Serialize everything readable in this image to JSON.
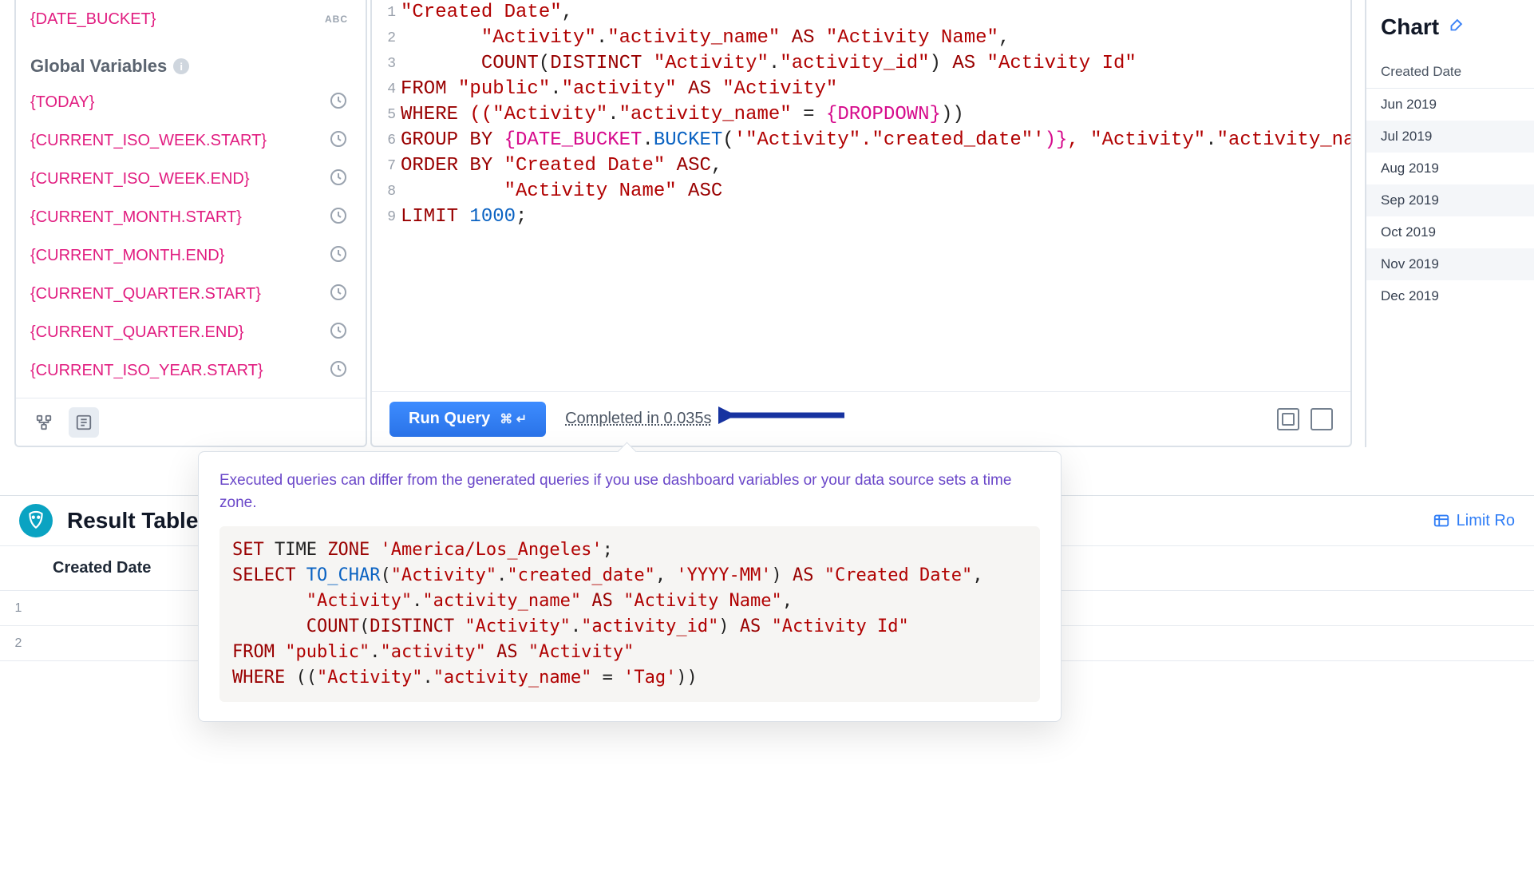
{
  "sidebar": {
    "first_var": "{DATE_BUCKET}",
    "first_var_type": "ABC",
    "section_title": "Global Variables",
    "items": [
      "{TODAY}",
      "{CURRENT_ISO_WEEK.START}",
      "{CURRENT_ISO_WEEK.END}",
      "{CURRENT_MONTH.START}",
      "{CURRENT_MONTH.END}",
      "{CURRENT_QUARTER.START}",
      "{CURRENT_QUARTER.END}",
      "{CURRENT_ISO_YEAR.START}"
    ]
  },
  "editor": {
    "line_numbers": [
      "1",
      "2",
      "3",
      "4",
      "5",
      "6",
      "7",
      "8",
      "9"
    ],
    "run_label": "Run Query",
    "run_shortcut": "⌘ ↵",
    "completed_label": "Completed in 0.035s"
  },
  "sql_tokens": {
    "l1_a": "\"Created Date\"",
    "l1_b": ",",
    "l2_a": "       \"Activity\"",
    "l2_b": ".",
    "l2_c": "\"activity_name\"",
    "l2_d": " AS ",
    "l2_e": "\"Activity Name\"",
    "l2_f": ",",
    "l3_a": "       COUNT",
    "l3_b": "(",
    "l3_c": "DISTINCT",
    "l3_d": " \"Activity\"",
    "l3_e": ".",
    "l3_f": "\"activity_id\"",
    "l3_g": ") ",
    "l3_h": "AS",
    "l3_i": " \"Activity Id\"",
    "l4_a": "FROM ",
    "l4_b": "\"public\"",
    "l4_c": ".",
    "l4_d": "\"activity\"",
    "l4_e": " AS ",
    "l4_f": "\"Activity\"",
    "l5_a": "WHERE ",
    "l5_b": "((\"Activity\"",
    "l5_c": ".",
    "l5_d": "\"activity_name\"",
    "l5_e": " = ",
    "l5_f": "{DROPDOWN}",
    "l5_g": "))",
    "l6_a": "GROUP BY ",
    "l6_b": "{DATE_BUCKET",
    "l6_c": ".",
    "l6_d": "BUCKET",
    "l6_e": "(",
    "l6_f": "'\"Activity\".\"created_date\"'",
    "l6_g": ")}",
    "l6_h": ", \"Activity\"",
    "l6_i": ".",
    "l6_j": "\"activity_name\"",
    "l7_a": "ORDER BY ",
    "l7_b": "\"Created Date\"",
    "l7_c": " ASC",
    "l7_d": ",",
    "l8_a": "         \"Activity Name\"",
    "l8_b": " ASC",
    "l9_a": "LIMIT ",
    "l9_b": "1000",
    "l9_c": ";"
  },
  "chart": {
    "title": "Chart",
    "header": "Created Date",
    "rows": [
      "Jun 2019",
      "Jul 2019",
      "Aug 2019",
      "Sep 2019",
      "Oct 2019",
      "Nov 2019",
      "Dec 2019"
    ]
  },
  "results": {
    "title": "Result Table",
    "col0": "Created Date",
    "limit_label": "Limit Ro",
    "row_nums": [
      "1",
      "2"
    ]
  },
  "popover": {
    "msg": "Executed queries can differ from the generated queries if you use dashboard variables or your data source sets a time zone."
  },
  "popover_sql": {
    "l1_a": "SET",
    "l1_b": " TIME ",
    "l1_c": "ZONE",
    "l1_d": " ",
    "l1_e": "'America/Los_Angeles'",
    "l1_f": ";",
    "l2_a": "SELECT ",
    "l2_b": "TO_CHAR",
    "l2_c": "(",
    "l2_d": "\"Activity\"",
    "l2_e": ".",
    "l2_f": "\"created_date\"",
    "l2_g": ", ",
    "l2_h": "'YYYY-MM'",
    "l2_i": ") ",
    "l2_j": "AS",
    "l2_k": " ",
    "l2_l": "\"Created Date\"",
    "l2_m": ",",
    "l3_a": "       ",
    "l3_b": "\"Activity\"",
    "l3_c": ".",
    "l3_d": "\"activity_name\"",
    "l3_e": " ",
    "l3_f": "AS",
    "l3_g": " ",
    "l3_h": "\"Activity Name\"",
    "l3_i": ",",
    "l4_a": "       ",
    "l4_b": "COUNT",
    "l4_c": "(",
    "l4_d": "DISTINCT",
    "l4_e": " ",
    "l4_f": "\"Activity\"",
    "l4_g": ".",
    "l4_h": "\"activity_id\"",
    "l4_i": ") ",
    "l4_j": "AS",
    "l4_k": " ",
    "l4_l": "\"Activity Id\"",
    "l5_a": "FROM ",
    "l5_b": "\"public\"",
    "l5_c": ".",
    "l5_d": "\"activity\"",
    "l5_e": " ",
    "l5_f": "AS",
    "l5_g": " ",
    "l5_h": "\"Activity\"",
    "l6_a": "WHERE ",
    "l6_b": "((",
    "l6_c": "\"Activity\"",
    "l6_d": ".",
    "l6_e": "\"activity_name\"",
    "l6_f": " = ",
    "l6_g": "'Tag'",
    "l6_h": "))"
  }
}
